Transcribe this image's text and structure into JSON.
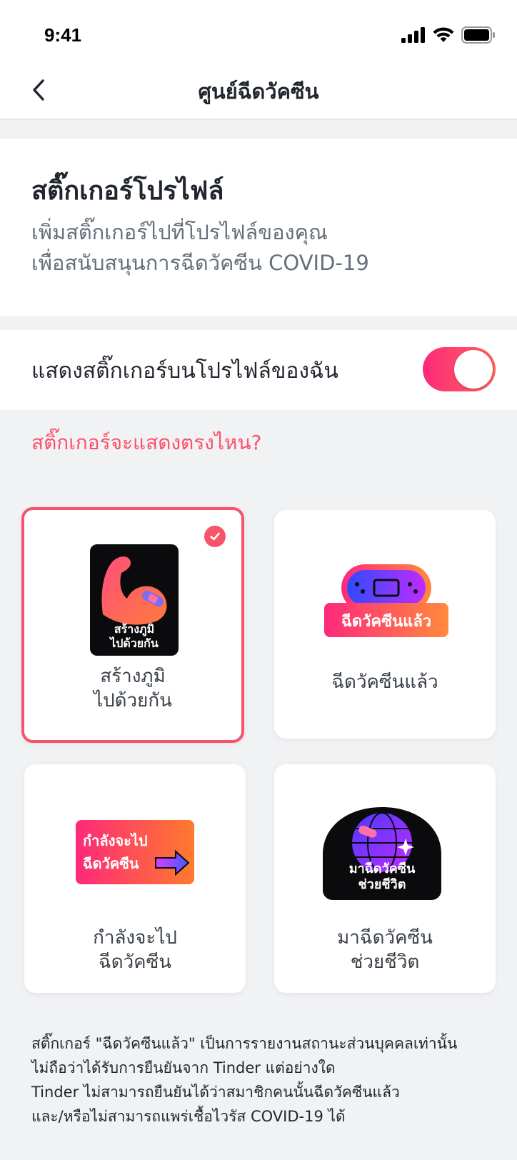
{
  "status_bar": {
    "time": "9:41"
  },
  "nav": {
    "title": "ศูนย์ฉีดวัคซีน",
    "back_icon": "chevron-left-icon"
  },
  "profile_section": {
    "title": "สติ๊กเกอร์โปรไฟล์",
    "desc_line1": "เพิ่มสติ๊กเกอร์ไปที่โปรไฟล์ของคุณ",
    "desc_line2": "เพื่อสนับสนุนการฉีดวัคซีน COVID-19"
  },
  "toggle_row": {
    "label": "แสดงสติ๊กเกอร์บนโปรไฟล์ของฉัน",
    "enabled": true
  },
  "where_link": "สติ๊กเกอร์จะแสดงตรงไหน?",
  "stickers": [
    {
      "label_line1": "สร้างภูมิ",
      "label_line2": "ไปด้วยกัน",
      "art_line1": "สร้างภูมิ",
      "art_line2": "ไปด้วยกัน",
      "selected": true
    },
    {
      "label_line1": "ฉีดวัคซีนแล้ว",
      "label_line2": "",
      "art_line1": "ฉีดวัคซีนแล้ว",
      "selected": false
    },
    {
      "label_line1": "กำลังจะไป",
      "label_line2": "ฉีดวัคซีน",
      "art_line1": "กำลังจะไป",
      "art_line2": "ฉีดวัคซีน",
      "selected": false
    },
    {
      "label_line1": "มาฉีดวัคซีน",
      "label_line2": "ช่วยชีวิต",
      "art_line1": "มาฉีดวัคซีน",
      "art_line2": "ช่วยชีวิต",
      "selected": false
    }
  ],
  "footnote": {
    "line1": "สติ๊กเกอร์ \"ฉีดวัคซีนแล้ว\" เป็นการรายงานสถานะส่วนบุคคลเท่านั้น",
    "line2": "ไม่ถือว่าได้รับการยืนยันจาก Tinder แต่อย่างใด",
    "line3": "Tinder ไม่สามารถยืนยันได้ว่าสมาชิกคนนั้นฉีดวัคซีนแล้ว",
    "line4": "และ/หรือไม่สามารถแพร่เชื้อไวรัส COVID-19 ได้"
  },
  "colors": {
    "accent": "#FD5068",
    "toggle_start": "#FD297B",
    "toggle_end": "#FF655B",
    "background": "#F1F2F4"
  }
}
